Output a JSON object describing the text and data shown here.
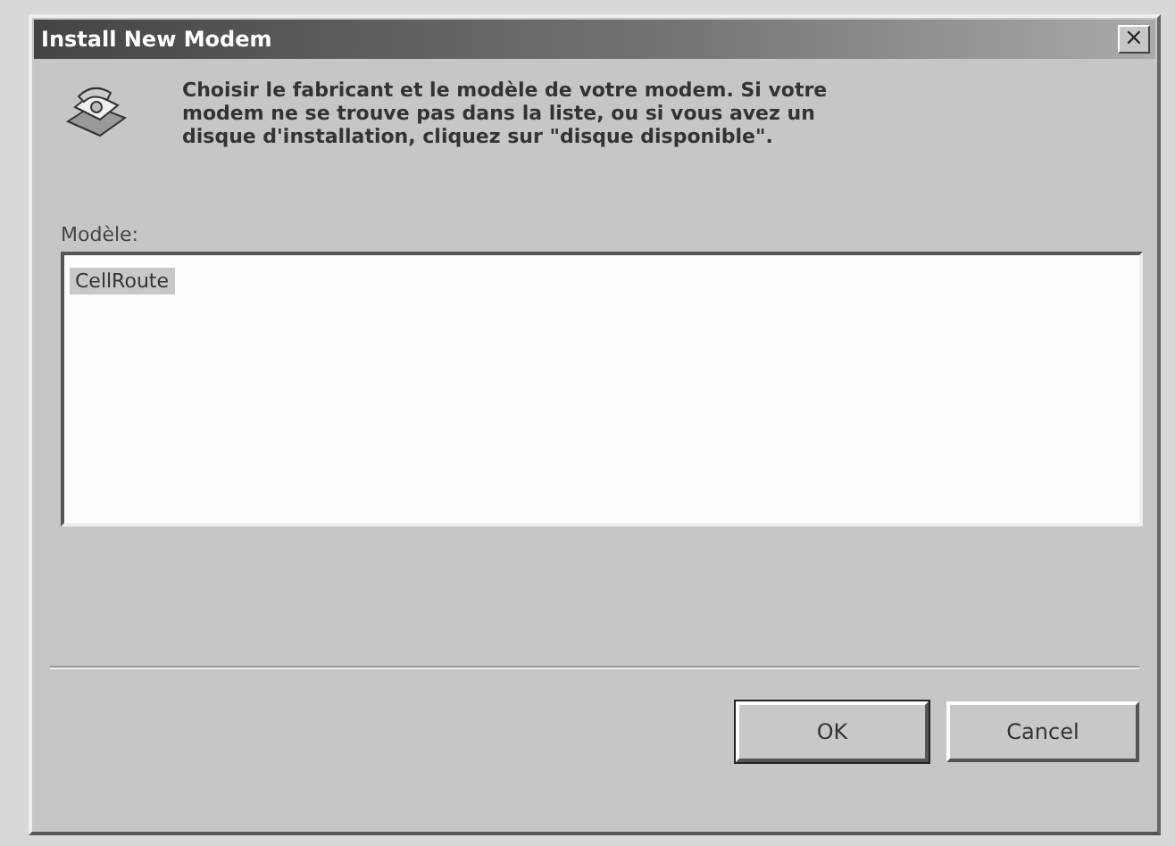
{
  "window": {
    "title": "Install New Modem",
    "close": "×"
  },
  "instructions": "Choisir le fabricant et le modèle de votre modem. Si votre modem ne se trouve pas dans la liste, ou si vous avez un disque d'installation, cliquez sur \"disque disponible\".",
  "list": {
    "label": "Modèle:",
    "items": [
      {
        "text": "CellRoute",
        "selected": true
      }
    ]
  },
  "buttons": [
    {
      "label": "OK",
      "default": true
    },
    {
      "label": "Cancel",
      "default": false
    }
  ]
}
